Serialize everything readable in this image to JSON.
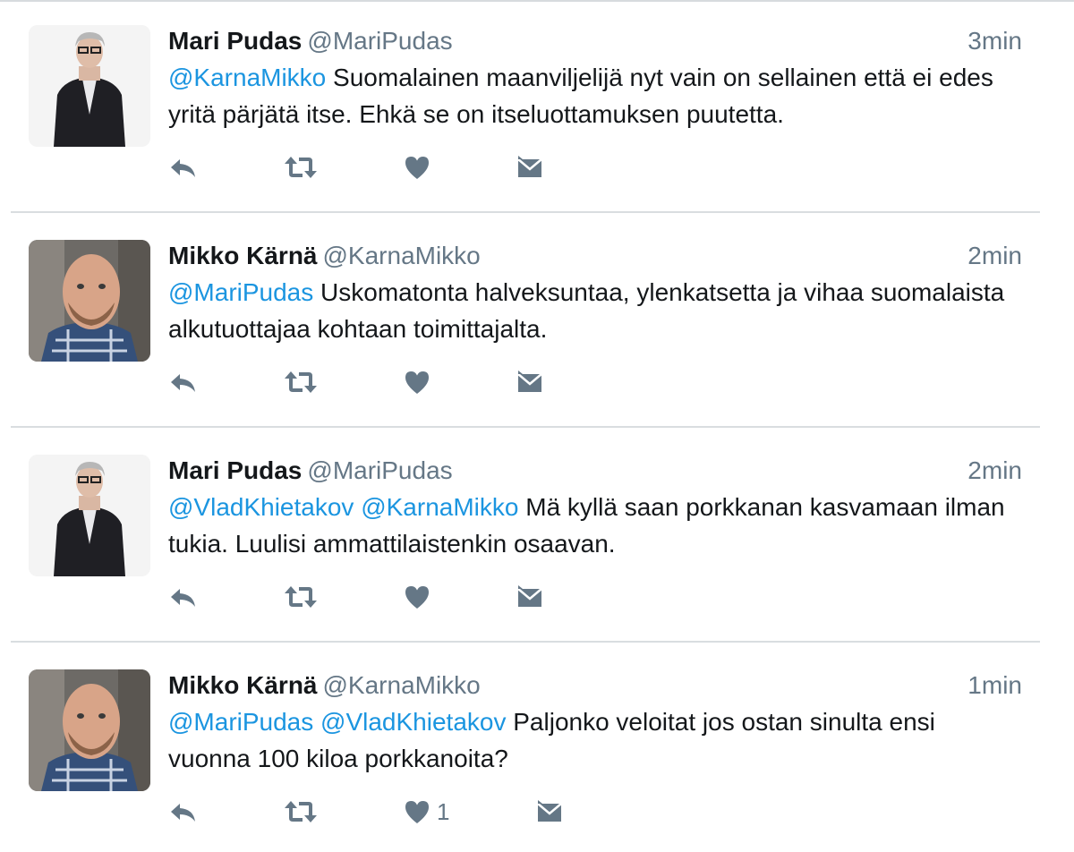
{
  "tweets": [
    {
      "name": "Mari Pudas",
      "handle": "@MariPudas",
      "time": "3min",
      "avatar": "mari-pudas-avatar",
      "mentions": "@KarnaMikko",
      "text": " Suomalainen maanviljelijä nyt vain on sellainen että ei edes yritä pärjätä itse. Ehkä se on itseluottamuksen puutetta.",
      "like_count": ""
    },
    {
      "name": "Mikko Kärnä",
      "handle": "@KarnaMikko",
      "time": "2min",
      "avatar": "mikko-karna-avatar",
      "mentions": "@MariPudas",
      "text": " Uskomatonta halveksuntaa, ylenkatsetta ja vihaa suomalaista alkutuottajaa kohtaan toimittajalta.",
      "like_count": ""
    },
    {
      "name": "Mari Pudas",
      "handle": "@MariPudas",
      "time": "2min",
      "avatar": "mari-pudas-avatar",
      "mentions": "@VladKhietakov @KarnaMikko",
      "text": " Mä kyllä saan porkkanan kasvamaan ilman tukia. Luulisi ammattilaistenkin osaavan.",
      "like_count": ""
    },
    {
      "name": "Mikko Kärnä",
      "handle": "@KarnaMikko",
      "time": "1min",
      "avatar": "mikko-karna-avatar",
      "mentions": "@MariPudas @VladKhietakov",
      "text": " Paljonko veloitat jos ostan sinulta ensi vuonna 100 kiloa porkkanoita?",
      "like_count": "1"
    }
  ],
  "icons": {
    "reply": "reply-icon",
    "retweet": "retweet-icon",
    "like": "heart-icon",
    "dm": "direct-message-icon"
  },
  "colors": {
    "link": "#1b95e0",
    "icon": "#657786",
    "divider": "#d9dde0"
  }
}
